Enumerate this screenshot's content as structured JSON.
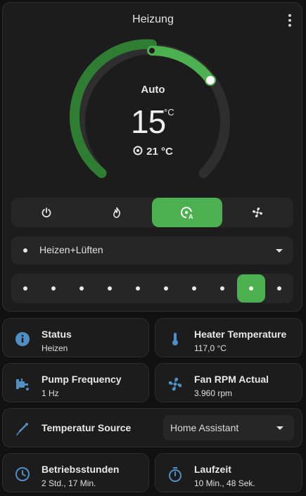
{
  "thermostat": {
    "title": "Heizung",
    "mode_label": "Auto",
    "target_temp": "15",
    "target_unit": "°C",
    "current_temp": "21 °C",
    "hvac_modes": [
      {
        "name": "power-icon",
        "active": false
      },
      {
        "name": "flame-icon",
        "active": false
      },
      {
        "name": "thermostat-auto-icon",
        "active": true
      },
      {
        "name": "fan-icon",
        "active": false
      }
    ],
    "preset": "Heizen+Lüften",
    "fan_steps_count": 10,
    "fan_active_step": 9,
    "colors": {
      "accent": "#4caf50",
      "dial_dark_green": "#2e7d32",
      "track": "#2e2e2e"
    }
  },
  "tiles": [
    {
      "name": "Status",
      "value": "Heizen",
      "icon": "info-icon"
    },
    {
      "name": "Heater Temperature",
      "value": "117,0 °C",
      "icon": "thermometer-icon"
    },
    {
      "name": "Pump Frequency",
      "value": "1 Hz",
      "icon": "pump-icon"
    },
    {
      "name": "Fan RPM Actual",
      "value": "3.960 rpm",
      "icon": "fan-icon"
    },
    {
      "name": "Temperatur Source",
      "value": "Home Assistant",
      "icon": "thermometer-probe-icon"
    },
    {
      "name": "Betriebsstunden",
      "value": "2 Std., 17 Min.",
      "icon": "clock-icon"
    },
    {
      "name": "Laufzeit",
      "value": "10 Min., 48 Sek.",
      "icon": "timer-icon"
    }
  ],
  "icon_color": "#4f8fc4"
}
